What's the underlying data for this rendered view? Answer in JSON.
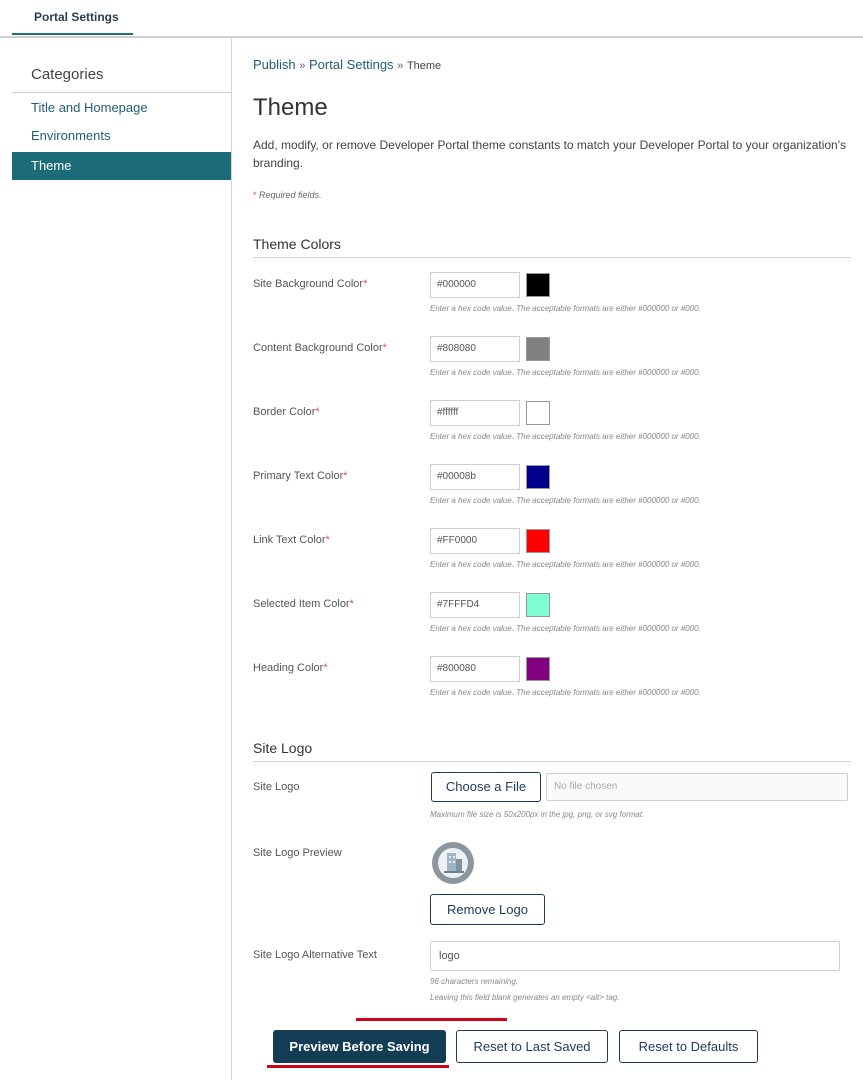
{
  "top_tab": {
    "label": "Portal Settings"
  },
  "sidebar": {
    "title": "Categories",
    "items": [
      {
        "label": "Title and Homepage",
        "active": false
      },
      {
        "label": "Environments",
        "active": false
      },
      {
        "label": "Theme",
        "active": true
      }
    ]
  },
  "breadcrumb": {
    "part1": "Publish",
    "sep": "»",
    "part2": "Portal Settings",
    "current": "Theme"
  },
  "page": {
    "title": "Theme",
    "description": "Add, modify, or remove Developer Portal theme constants to match your Developer Portal to your organization's branding.",
    "required_star": "*",
    "required_note": "Required fields."
  },
  "theme_colors": {
    "section_title": "Theme Colors",
    "hint": "Enter a hex code value. The acceptable formats are either #000000 or #000.",
    "rows": [
      {
        "label": "Site Background Color",
        "value": "#000000",
        "swatch": "#000000"
      },
      {
        "label": "Content Background Color",
        "value": "#808080",
        "swatch": "#808080"
      },
      {
        "label": "Border Color",
        "value": "#ffffff",
        "swatch": "#ffffff"
      },
      {
        "label": "Primary Text Color",
        "value": "#00008b",
        "swatch": "#00008b"
      },
      {
        "label": "Link Text Color",
        "value": "#FF0000",
        "swatch": "#FF0000"
      },
      {
        "label": "Selected Item Color",
        "value": "#7FFFD4",
        "swatch": "#7FFFD4"
      },
      {
        "label": "Heading Color",
        "value": "#800080",
        "swatch": "#800080"
      }
    ]
  },
  "site_logo": {
    "section_title": "Site Logo",
    "logo_label": "Site Logo",
    "choose_file": "Choose a File",
    "no_file": "No file chosen",
    "size_hint": "Maximum file size is 50x200px in the jpg, png, or svg format.",
    "preview_label": "Site Logo Preview",
    "remove_logo": "Remove Logo",
    "alt_label": "Site Logo Alternative Text",
    "alt_value": "logo",
    "chars_remaining": "96 characters remaining.",
    "alt_hint": "Leaving this field blank generates an empty <alt> tag."
  },
  "actions": {
    "preview": "Preview Before Saving",
    "reset_last": "Reset to Last Saved",
    "reset_defaults": "Reset to Defaults"
  },
  "colors": {
    "accent": "#1c6b78",
    "primary_button": "#133c55",
    "highlight": "#d0021b",
    "required_star": "#d9534f"
  }
}
